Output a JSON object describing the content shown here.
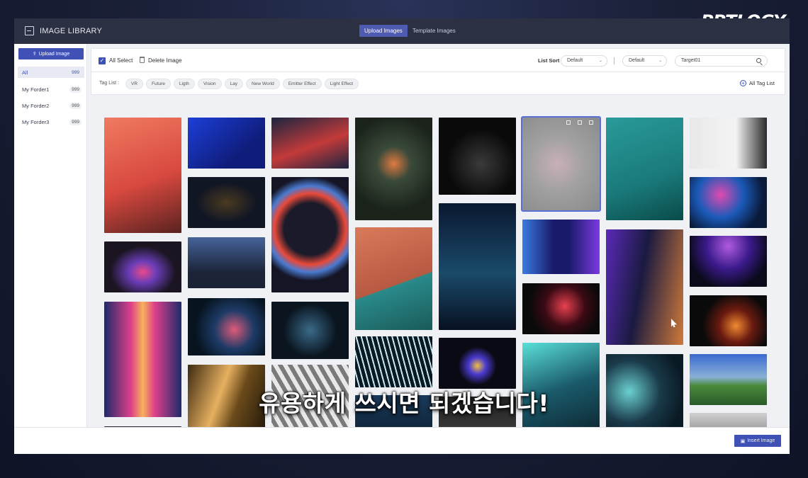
{
  "brand": {
    "logo": "PPTLOGY"
  },
  "window": {
    "title": "IMAGE LIBRARY",
    "tabs": [
      {
        "label": "Upload Images",
        "active": true
      },
      {
        "label": "Template Images",
        "active": false
      }
    ]
  },
  "sidebar": {
    "upload_label": "Upload Image",
    "folders": [
      {
        "label": "All",
        "count": "999",
        "active": true
      },
      {
        "label": "My Forder1",
        "count": "999",
        "active": false
      },
      {
        "label": "My Forder2",
        "count": "999",
        "active": false
      },
      {
        "label": "My Forder3",
        "count": "999",
        "active": false
      }
    ]
  },
  "toolbar": {
    "all_select": "All Select",
    "all_select_checked": true,
    "delete_image": "Delete Image",
    "list_sort_label": "List Sort",
    "sort1": "Default",
    "sort2": "Default",
    "search_value": "Target01"
  },
  "tagbar": {
    "title": "Tag List :",
    "tags": [
      "VR",
      "Future",
      "Ligth",
      "Vision",
      "Lay",
      "New World",
      "Emitter Effect",
      "Light Effect"
    ],
    "all_tag_list": "All Tag List"
  },
  "footer": {
    "insert_label": "Insert Image"
  },
  "caption": "유용하게 쓰시면 되겠습니다!",
  "colors": {
    "accent": "#3f51b5",
    "titlebar": "#2b3042"
  }
}
